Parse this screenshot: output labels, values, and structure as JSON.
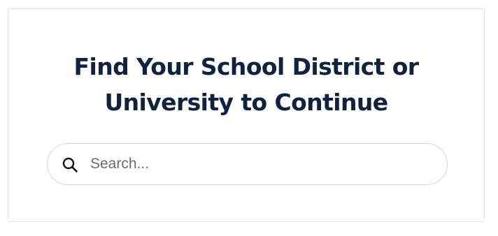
{
  "card": {
    "title_line1": "Find Your School District or",
    "title_line2": "University to Continue"
  },
  "search": {
    "icon": "search-icon",
    "value": "",
    "placeholder": "Search..."
  },
  "colors": {
    "title": "#0f2340",
    "border": "#d6d6d6",
    "placeholder": "#6b6b6b"
  }
}
